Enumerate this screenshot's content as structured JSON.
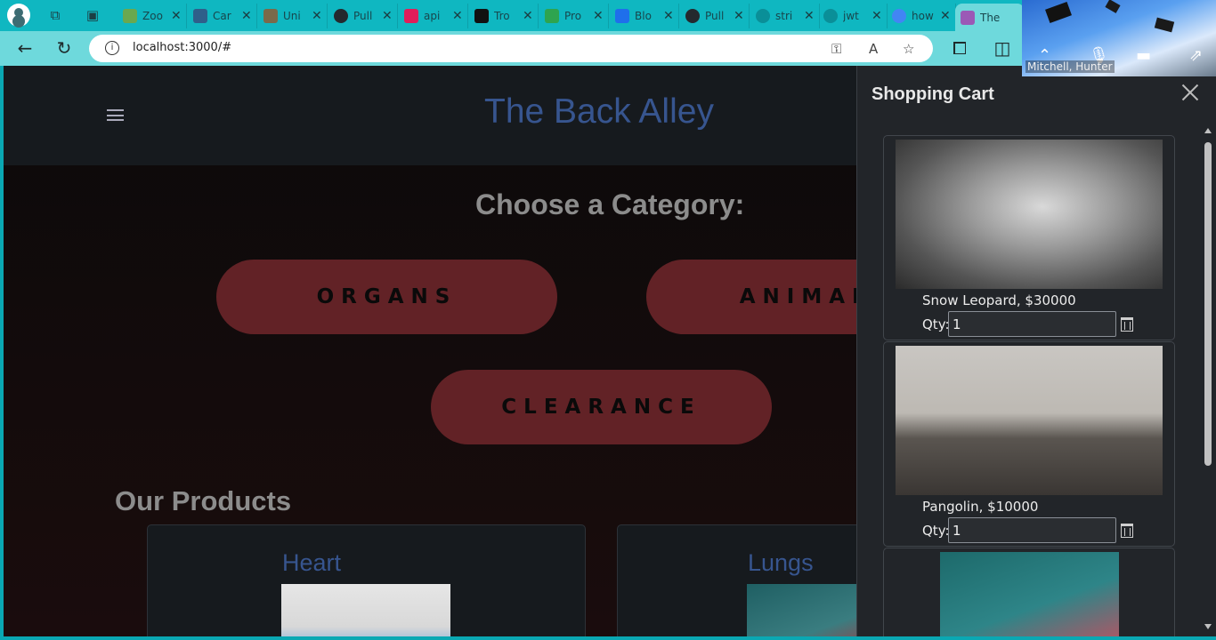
{
  "browser": {
    "tabs": [
      {
        "label": "Zoo",
        "favicon_color": "#6aa84f"
      },
      {
        "label": "Car",
        "favicon_color": "#2f5f8a"
      },
      {
        "label": "Uni",
        "favicon_color": "#7a6a4a"
      },
      {
        "label": "Pull",
        "favicon_color": "#24292e"
      },
      {
        "label": "api",
        "favicon_color": "#e01e5a"
      },
      {
        "label": "Tro",
        "favicon_color": "#111111"
      },
      {
        "label": "Pro",
        "favicon_color": "#2ea44f"
      },
      {
        "label": "Blo",
        "favicon_color": "#1f6feb"
      },
      {
        "label": "Pull",
        "favicon_color": "#24292e"
      },
      {
        "label": "stri",
        "favicon_color": "#0fb7c1"
      },
      {
        "label": "jwt",
        "favicon_color": "#0fb7c1"
      },
      {
        "label": "how",
        "favicon_color": "#4285f4"
      },
      {
        "label": "The",
        "favicon_color": "#9b59b6"
      }
    ],
    "url": "localhost:3000/#",
    "video_caller_name": "Mitchell, Hunter"
  },
  "header": {
    "title": "The Back Alley"
  },
  "categories": {
    "heading": "Choose a Category:",
    "buttons": [
      "ORGANS",
      "ANIMALS",
      "CLEARANCE"
    ]
  },
  "products": {
    "heading": "Our Products",
    "items": [
      {
        "name": "Heart"
      },
      {
        "name": "Lungs"
      }
    ]
  },
  "cart": {
    "title": "Shopping Cart",
    "qty_label": "Qty:",
    "items": [
      {
        "name": "Snow Leopard, $30000",
        "qty": "1"
      },
      {
        "name": "Pangolin, $10000",
        "qty": "1"
      }
    ]
  },
  "colors": {
    "accent_title": "#37558f",
    "category_button": "#622226",
    "header_bg": "#161a1e",
    "browser_chrome": "#0fb7c1"
  }
}
